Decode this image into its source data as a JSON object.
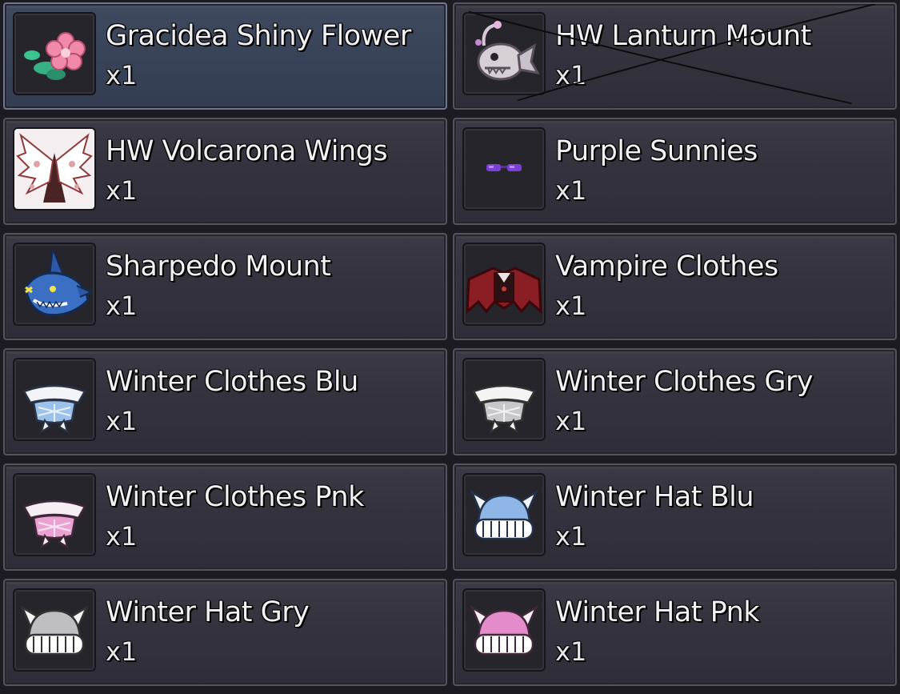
{
  "inventory": {
    "items": [
      {
        "name": "Gracidea Shiny Flower",
        "qty": "x1",
        "icon": "flower-icon",
        "selected": true
      },
      {
        "name": "HW Lanturn Mount",
        "qty": "x1",
        "icon": "lanturn-icon",
        "crossed_out": true
      },
      {
        "name": "HW Volcarona Wings",
        "qty": "x1",
        "icon": "wings-icon"
      },
      {
        "name": "Purple Sunnies",
        "qty": "x1",
        "icon": "sunglasses-icon"
      },
      {
        "name": "Sharpedo Mount",
        "qty": "x1",
        "icon": "shark-icon"
      },
      {
        "name": "Vampire Clothes",
        "qty": "x1",
        "icon": "cape-icon"
      },
      {
        "name": "Winter Clothes Blu",
        "qty": "x1",
        "icon": "winter-clothes-blue-icon"
      },
      {
        "name": "Winter Clothes Gry",
        "qty": "x1",
        "icon": "winter-clothes-gray-icon"
      },
      {
        "name": "Winter Clothes Pnk",
        "qty": "x1",
        "icon": "winter-clothes-pink-icon"
      },
      {
        "name": "Winter Hat Blu",
        "qty": "x1",
        "icon": "winter-hat-blue-icon"
      },
      {
        "name": "Winter Hat Gry",
        "qty": "x1",
        "icon": "winter-hat-gray-icon"
      },
      {
        "name": "Winter Hat Pnk",
        "qty": "x1",
        "icon": "winter-hat-pink-icon"
      }
    ]
  },
  "colors": {
    "panel": "#34333d",
    "selected_panel": "#3a4458",
    "text": "#f1f1f4"
  }
}
